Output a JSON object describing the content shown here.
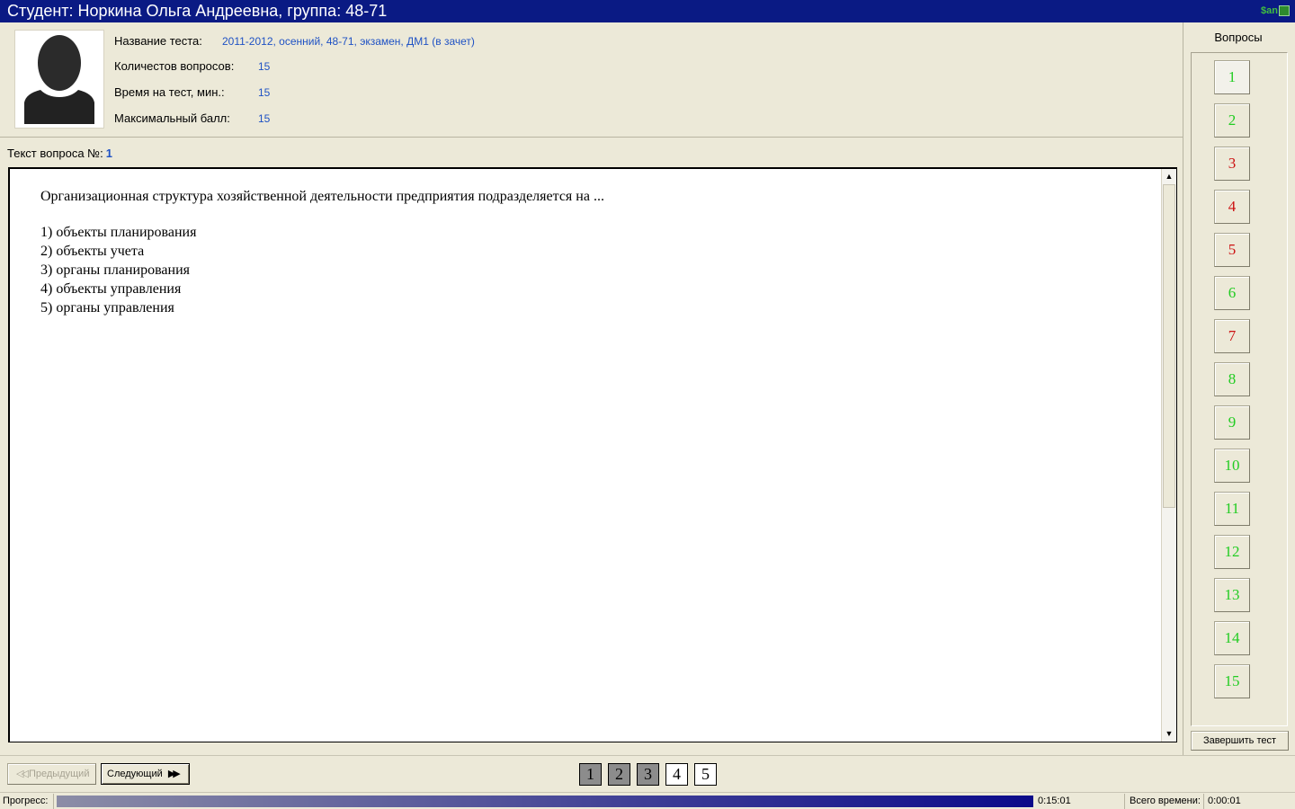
{
  "window": {
    "title": "Студент: Норкина Ольга Андреевна, группа: 48-71",
    "logo_text": "$an"
  },
  "info": {
    "test_name_label": "Название теста:",
    "test_name_value": "2011-2012, осенний, 48-71, экзамен, ДМ1 (в зачет)",
    "questions_count_label": "Количестов вопросов:",
    "questions_count_value": "15",
    "time_label": "Время на тест, мин.:",
    "time_value": "15",
    "max_score_label": "Максимальный балл:",
    "max_score_value": "15"
  },
  "question": {
    "label": "Текст вопроса №:",
    "number": "1",
    "text": "Организационная структура хозяйственной деятельности предприятия подразделяется на ...",
    "answers": [
      "1) объекты планирования",
      "2) объекты учета",
      "3) органы планирования",
      "4) объекты управления",
      "5) органы управления"
    ]
  },
  "sidebar": {
    "title": "Вопросы",
    "questions": [
      {
        "label": "1",
        "status": "green"
      },
      {
        "label": "2",
        "status": "green"
      },
      {
        "label": "3",
        "status": "red"
      },
      {
        "label": "4",
        "status": "red"
      },
      {
        "label": "5",
        "status": "red"
      },
      {
        "label": "6",
        "status": "green"
      },
      {
        "label": "7",
        "status": "red"
      },
      {
        "label": "8",
        "status": "green"
      },
      {
        "label": "9",
        "status": "green"
      },
      {
        "label": "10",
        "status": "green"
      },
      {
        "label": "11",
        "status": "green"
      },
      {
        "label": "12",
        "status": "green"
      },
      {
        "label": "13",
        "status": "green"
      },
      {
        "label": "14",
        "status": "green"
      },
      {
        "label": "15",
        "status": "green"
      }
    ],
    "finish_label": "Завершить тест"
  },
  "nav": {
    "prev_label": "Предыдущий",
    "next_label": "Следующий",
    "pages": [
      {
        "label": "1",
        "state": "done"
      },
      {
        "label": "2",
        "state": "done"
      },
      {
        "label": "3",
        "state": "done"
      },
      {
        "label": "4",
        "state": "open"
      },
      {
        "label": "5",
        "state": "open"
      }
    ]
  },
  "status": {
    "progress_label": "Прогресс:",
    "progress_fraction": 1.0,
    "time_left": "0:15:01",
    "total_time_label": "Всего времени:",
    "total_time": "0:00:01"
  },
  "colors": {
    "title_bar": "#0a1a84",
    "value_text": "#1f52c4",
    "answered_green": "#22cc22",
    "answered_red": "#cc1111"
  }
}
